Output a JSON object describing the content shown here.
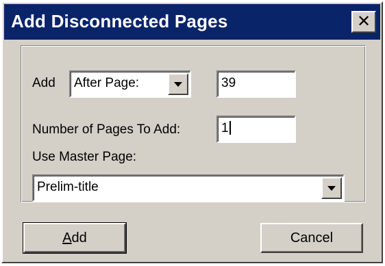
{
  "window": {
    "title": "Add Disconnected Pages",
    "close_glyph": "✕",
    "close_icon": "close-icon"
  },
  "form": {
    "add_label": "Add",
    "position_select": {
      "selected": "After Page:"
    },
    "page_number": {
      "value": "39"
    },
    "num_pages_label": "Number of Pages To Add:",
    "num_pages": {
      "value": "1"
    },
    "master_label": "Use Master Page:",
    "master_select": {
      "selected": "Prelim-title"
    }
  },
  "buttons": {
    "add": {
      "mnemonic": "A",
      "rest": "dd"
    },
    "cancel": {
      "label": "Cancel"
    }
  },
  "colors": {
    "titlebar": "#0a246a",
    "face": "#d4d0c8"
  }
}
